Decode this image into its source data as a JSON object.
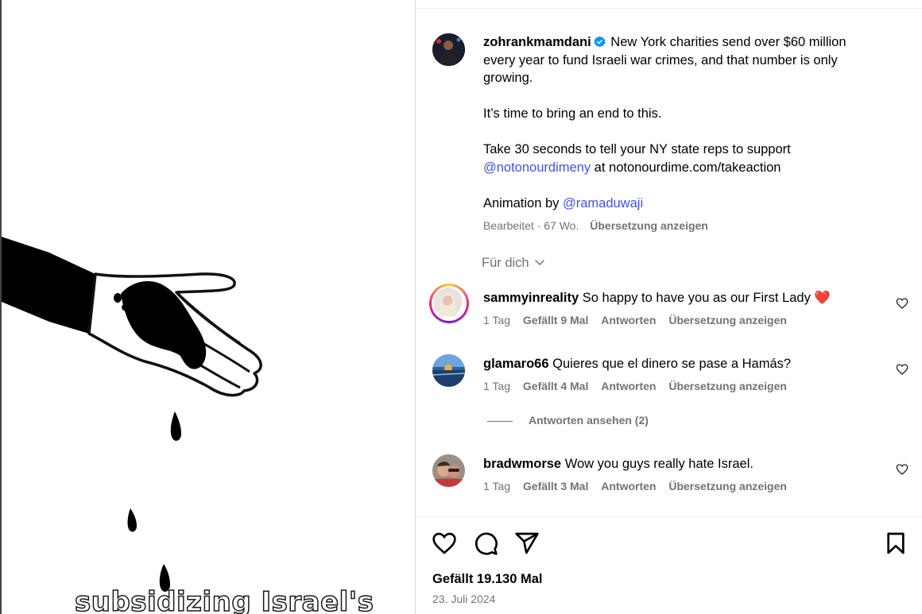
{
  "media": {
    "caption_overlay": "subsidizing Israel's"
  },
  "post": {
    "author": "zohrankmamdani",
    "caption_line1": "New York charities send over $60 million every year to fund Israeli war crimes, and that number is only growing.",
    "caption_line2": "It’s time to bring an end to this.",
    "caption_line3_pre": "Take 30 seconds to tell your NY state reps to support",
    "caption_line3_mention": "@notonourdimeny",
    "caption_line3_post": "at notonourdime.com/takeaction",
    "caption_line4_pre": "Animation by",
    "caption_line4_mention": "@ramaduwaji",
    "meta_edited": "Bearbeitet · 67 Wo.",
    "meta_translate": "Übersetzung anzeigen"
  },
  "for_you": "Für dich",
  "comments": [
    {
      "user": "sammyinreality",
      "text": "So happy to have you as our First Lady ❤️",
      "time": "1 Tag",
      "likes": "Gefällt 9 Mal",
      "reply": "Antworten",
      "translate": "Übersetzung anzeigen"
    },
    {
      "user": "glamaro66",
      "text": "Quieres que el dinero se pase a Hamás?",
      "time": "1 Tag",
      "likes": "Gefällt 4 Mal",
      "reply": "Antworten",
      "translate": "Übersetzung anzeigen"
    },
    {
      "user": "bradwmorse",
      "text": "Wow you guys really hate Israel.",
      "time": "1 Tag",
      "likes": "Gefällt 3 Mal",
      "reply": "Antworten",
      "translate": "Übersetzung anzeigen"
    }
  ],
  "view_replies": "Antworten ansehen (2)",
  "footer": {
    "likes": "Gefällt 19.130 Mal",
    "date": "23. Juli 2024"
  },
  "colors": {
    "accent_link": "#4150f7",
    "verified": "#0095f6",
    "secondary_text": "#737373"
  }
}
